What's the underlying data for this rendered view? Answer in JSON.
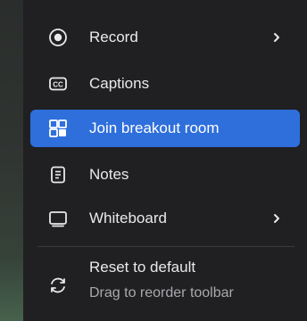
{
  "menu": {
    "items": [
      {
        "label": "Record",
        "icon": "record-icon",
        "has_submenu": true
      },
      {
        "label": "Captions",
        "icon": "captions-icon",
        "has_submenu": false
      },
      {
        "label": "Join breakout room",
        "icon": "breakout-rooms-icon",
        "has_submenu": false,
        "highlighted": true
      },
      {
        "label": "Notes",
        "icon": "notes-icon",
        "has_submenu": false
      },
      {
        "label": "Whiteboard",
        "icon": "whiteboard-icon",
        "has_submenu": true
      }
    ],
    "reset": {
      "label": "Reset to default",
      "hint": "Drag to reorder toolbar",
      "icon": "reset-icon"
    }
  },
  "colors": {
    "menu_bg": "#202022",
    "highlight": "#2f6fdc",
    "text": "#e9e9ea",
    "muted_text": "#a9a9ad"
  }
}
